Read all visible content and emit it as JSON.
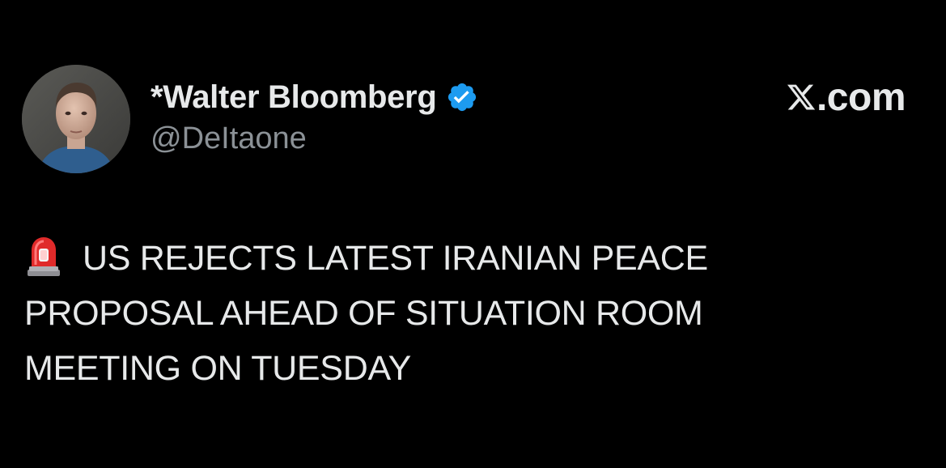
{
  "author": {
    "display_name": "*Walter Bloomberg",
    "handle": "@DeItaone",
    "verified": true,
    "verified_color": "#1d9bf0"
  },
  "brand": {
    "text": ".com",
    "logo_icon": "x-logo-icon"
  },
  "tweet": {
    "leading_emoji": "siren-icon",
    "lines": [
      "US REJECTS LATEST IRANIAN PEACE",
      "PROPOSAL AHEAD OF SITUATION ROOM",
      "MEETING ON TUESDAY"
    ]
  },
  "colors": {
    "background": "#000000",
    "text_primary": "#e7e9ea",
    "text_secondary": "#8b9196"
  }
}
